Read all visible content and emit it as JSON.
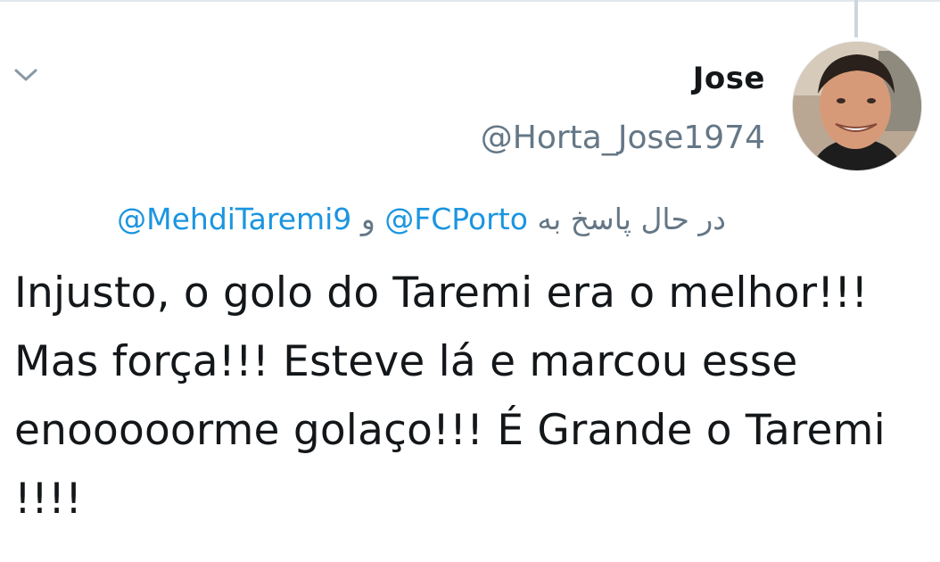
{
  "tweet": {
    "author": {
      "display_name": "Jose",
      "handle": "@Horta_Jose1974"
    },
    "reply_context": {
      "prefix": "در حال پاسخ به",
      "mention_1": "@FCPorto",
      "conjunction": "و",
      "mention_2": "@MehdiTaremi9"
    },
    "text": "Injusto, o golo do Taremi era o melhor!!! Mas força!!! Esteve lá e marcou esse enooooorme golaço!!! É Grande o Taremi !!!!"
  },
  "icons": {
    "menu": "chevron-down-icon",
    "avatar": "profile-photo"
  },
  "colors": {
    "link": "#1b95e0",
    "secondary": "#657786",
    "primary_text": "#14171a",
    "thread_line": "#ccd6dd"
  }
}
